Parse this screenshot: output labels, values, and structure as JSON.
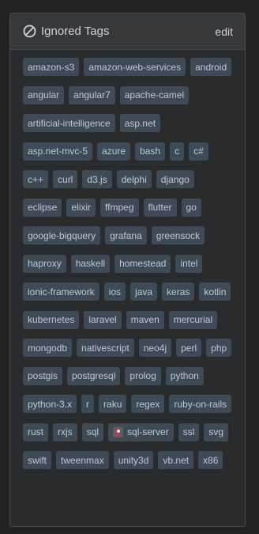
{
  "header": {
    "title": "Ignored Tags",
    "edit_label": "edit",
    "icon": "ban-icon"
  },
  "tags": [
    {
      "label": "amazon-s3"
    },
    {
      "label": "amazon-web-services"
    },
    {
      "label": "android"
    },
    {
      "label": "angular"
    },
    {
      "label": "angular7"
    },
    {
      "label": "apache-camel"
    },
    {
      "label": "artificial-intelligence"
    },
    {
      "label": "asp.net"
    },
    {
      "label": "asp.net-mvc-5"
    },
    {
      "label": "azure"
    },
    {
      "label": "bash"
    },
    {
      "label": "c"
    },
    {
      "label": "c#"
    },
    {
      "label": "c++"
    },
    {
      "label": "curl"
    },
    {
      "label": "d3.js"
    },
    {
      "label": "delphi"
    },
    {
      "label": "django"
    },
    {
      "label": "eclipse"
    },
    {
      "label": "elixir"
    },
    {
      "label": "ffmpeg"
    },
    {
      "label": "flutter"
    },
    {
      "label": "go"
    },
    {
      "label": "google-bigquery"
    },
    {
      "label": "grafana"
    },
    {
      "label": "greensock"
    },
    {
      "label": "haproxy"
    },
    {
      "label": "haskell"
    },
    {
      "label": "homestead"
    },
    {
      "label": "intel"
    },
    {
      "label": "ionic-framework"
    },
    {
      "label": "ios"
    },
    {
      "label": "java"
    },
    {
      "label": "keras"
    },
    {
      "label": "kotlin"
    },
    {
      "label": "kubernetes"
    },
    {
      "label": "laravel"
    },
    {
      "label": "maven"
    },
    {
      "label": "mercurial"
    },
    {
      "label": "mongodb"
    },
    {
      "label": "nativescript"
    },
    {
      "label": "neo4j"
    },
    {
      "label": "perl"
    },
    {
      "label": "php"
    },
    {
      "label": "postgis"
    },
    {
      "label": "postgresql"
    },
    {
      "label": "prolog"
    },
    {
      "label": "python"
    },
    {
      "label": "python-3.x"
    },
    {
      "label": "r"
    },
    {
      "label": "raku"
    },
    {
      "label": "regex"
    },
    {
      "label": "ruby-on-rails"
    },
    {
      "label": "rust"
    },
    {
      "label": "rxjs"
    },
    {
      "label": "sql"
    },
    {
      "label": "sql-server",
      "icon": "sql-server-logo-icon"
    },
    {
      "label": "ssl"
    },
    {
      "label": "svg"
    },
    {
      "label": "swift"
    },
    {
      "label": "tweenmax"
    },
    {
      "label": "unity3d"
    },
    {
      "label": "vb.net"
    },
    {
      "label": "x86"
    }
  ],
  "colors": {
    "page_background": "#222222",
    "panel_background": "#2a2b2c",
    "header_background": "#37383a",
    "tag_background": "#3e4a55",
    "tag_text": "#bccad6",
    "header_text": "#cfd2d6"
  }
}
